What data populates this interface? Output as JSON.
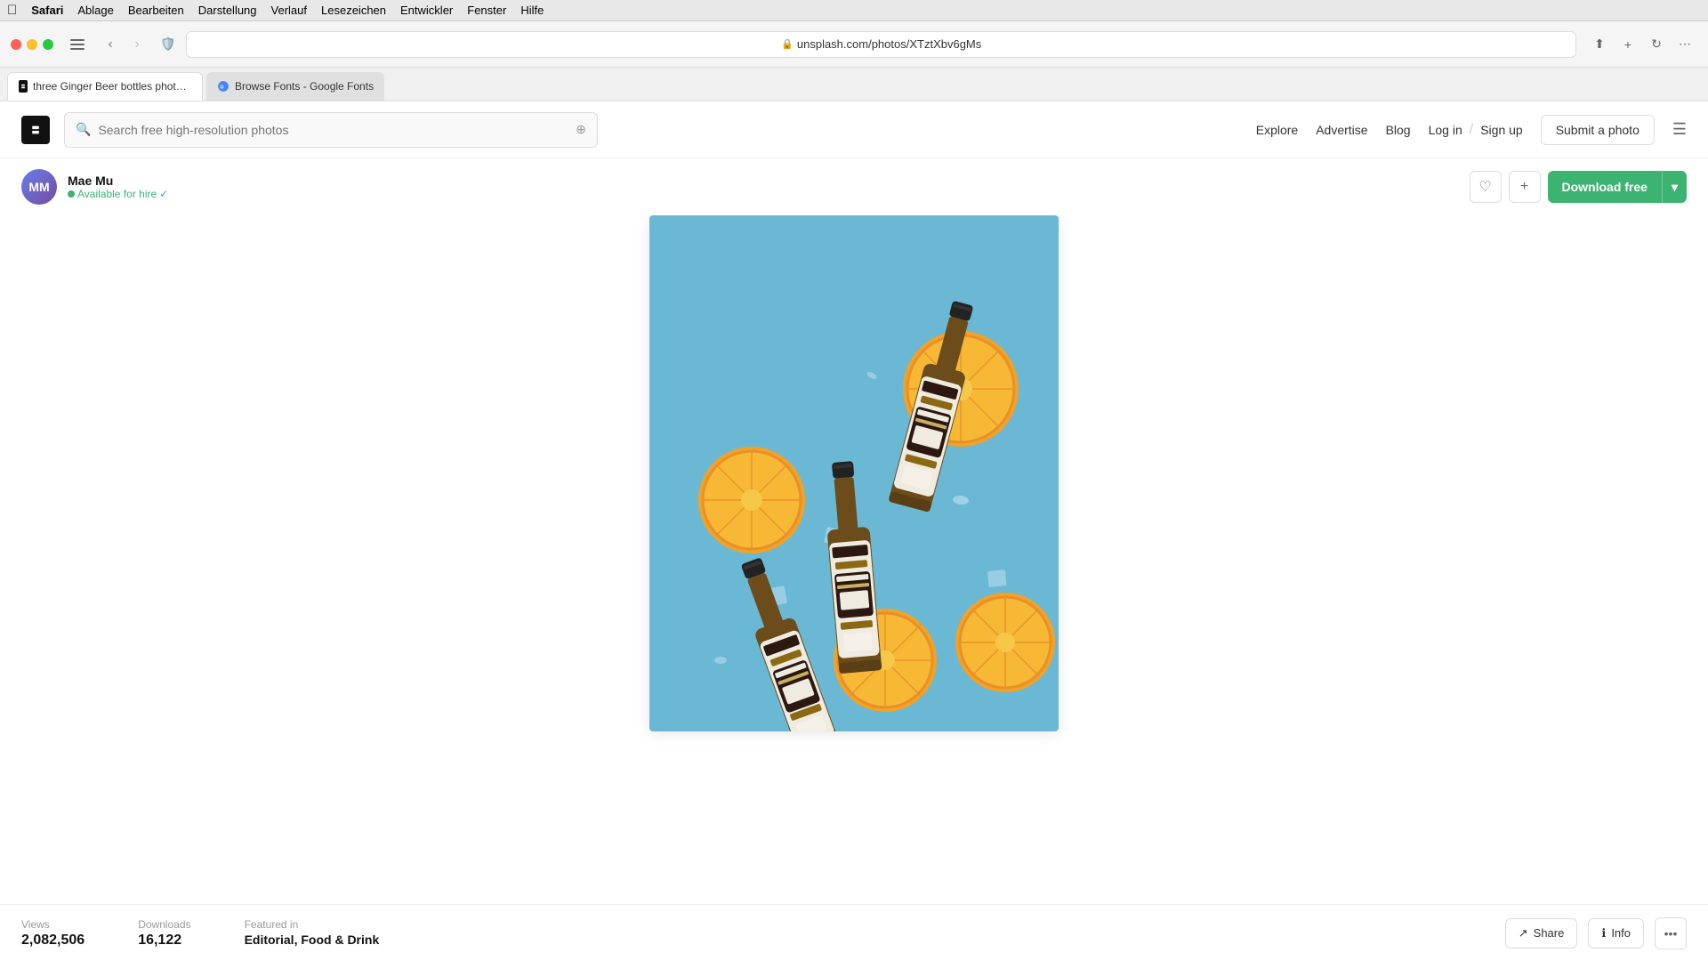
{
  "macos": {
    "menu_items": [
      "",
      "Safari",
      "Ablage",
      "Bearbeiten",
      "Darstellung",
      "Verlauf",
      "Lesezeichen",
      "Entwickler",
      "Fenster",
      "Hilfe"
    ]
  },
  "browser": {
    "url": "unsplash.com/photos/XTztXbv6gMs",
    "tab1_label": "three Ginger Beer bottles photo – Free Food Image on Unsplash",
    "tab2_label": "Browse Fonts - Google Fonts",
    "back_disabled": false,
    "forward_disabled": false
  },
  "unsplash": {
    "logo_text": "U",
    "search_placeholder": "Search free high-resolution photos",
    "nav": {
      "explore": "Explore",
      "advertise": "Advertise",
      "blog": "Blog",
      "login": "Log in",
      "signup": "Sign up",
      "submit_photo": "Submit a photo"
    },
    "photographer": {
      "name": "Mae Mu",
      "available_text": "Available for hire",
      "avatar_initials": "MM"
    },
    "download_btn": "Download free",
    "photo_alt": "Three ginger beer bottles with oranges and ice on blue background",
    "stats": {
      "views_label": "Views",
      "views_value": "2,082,506",
      "downloads_label": "Downloads",
      "downloads_value": "16,122",
      "featured_label": "Featured in",
      "featured_value": "Editorial, Food & Drink"
    },
    "actions": {
      "share": "Share",
      "info": "Info"
    }
  }
}
